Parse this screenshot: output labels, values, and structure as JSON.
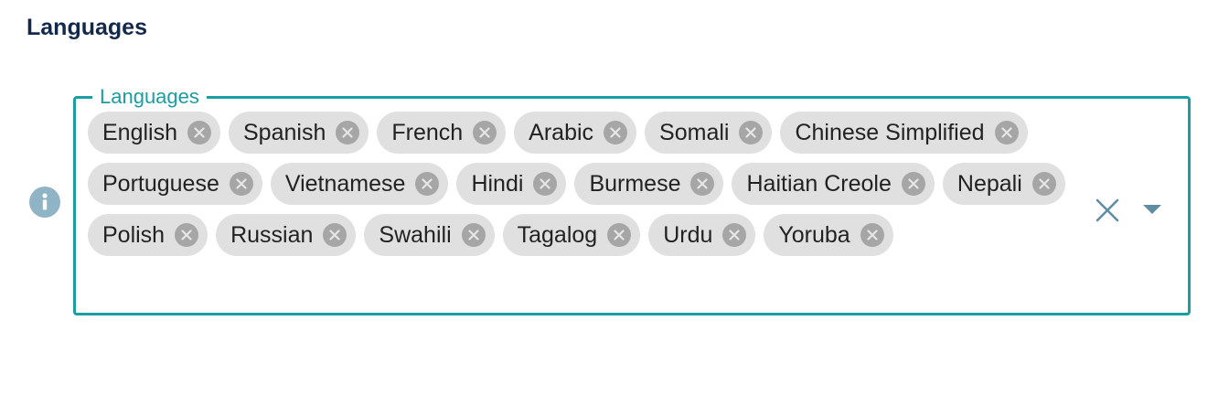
{
  "section": {
    "title": "Languages"
  },
  "field": {
    "label": "Languages",
    "border_color": "#1a9ea3",
    "chips": [
      {
        "label": "English"
      },
      {
        "label": "Spanish"
      },
      {
        "label": "French"
      },
      {
        "label": "Arabic"
      },
      {
        "label": "Somali"
      },
      {
        "label": "Chinese Simplified"
      },
      {
        "label": "Portuguese"
      },
      {
        "label": "Vietnamese"
      },
      {
        "label": "Hindi"
      },
      {
        "label": "Burmese"
      },
      {
        "label": "Haitian Creole"
      },
      {
        "label": "Nepali"
      },
      {
        "label": "Polish"
      },
      {
        "label": "Russian"
      },
      {
        "label": "Swahili"
      },
      {
        "label": "Tagalog"
      },
      {
        "label": "Urdu"
      },
      {
        "label": "Yoruba"
      }
    ],
    "chip_remove_icon": "circle-x-icon",
    "clear_icon": "close-icon",
    "dropdown_icon": "caret-down-icon"
  },
  "info_icon": "info-icon"
}
